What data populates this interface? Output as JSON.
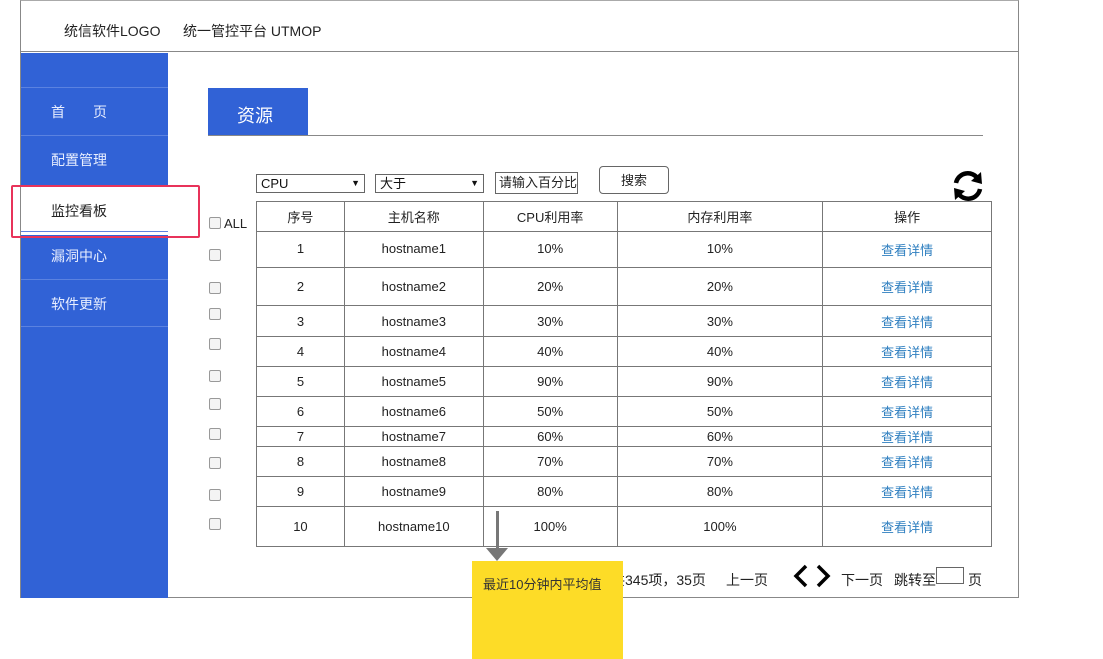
{
  "header": {
    "logo": "统信软件LOGO",
    "platform": "统一管控平台 UTMOP"
  },
  "sidebar": {
    "items": [
      {
        "label": "首　　页"
      },
      {
        "label": "配置管理"
      },
      {
        "label": "监控看板"
      },
      {
        "label": "漏洞中心"
      },
      {
        "label": "软件更新"
      }
    ]
  },
  "tab": {
    "label": "资源"
  },
  "filters": {
    "metric": "CPU",
    "operator": "大于",
    "pct_placeholder": "请输入百分比",
    "search_label": "搜索",
    "all_label": "ALL"
  },
  "table": {
    "headers": [
      "序号",
      "主机名称",
      "CPU利用率",
      "内存利用率",
      "操作"
    ],
    "rows": [
      {
        "no": "1",
        "host": "hostname1",
        "cpu": "10%",
        "mem": "10%",
        "action": "查看详情"
      },
      {
        "no": "2",
        "host": "hostname2",
        "cpu": "20%",
        "mem": "20%",
        "action": "查看详情"
      },
      {
        "no": "3",
        "host": "hostname3",
        "cpu": "30%",
        "mem": "30%",
        "action": "查看详情"
      },
      {
        "no": "4",
        "host": "hostname4",
        "cpu": "40%",
        "mem": "40%",
        "action": "查看详情"
      },
      {
        "no": "5",
        "host": "hostname5",
        "cpu": "90%",
        "mem": "90%",
        "action": "查看详情"
      },
      {
        "no": "6",
        "host": "hostname6",
        "cpu": "50%",
        "mem": "50%",
        "action": "查看详情"
      },
      {
        "no": "7",
        "host": "hostname7",
        "cpu": "60%",
        "mem": "60%",
        "action": "查看详情"
      },
      {
        "no": "8",
        "host": "hostname8",
        "cpu": "70%",
        "mem": "70%",
        "action": "查看详情"
      },
      {
        "no": "9",
        "host": "hostname9",
        "cpu": "80%",
        "mem": "80%",
        "action": "查看详情"
      },
      {
        "no": "10",
        "host": "hostname10",
        "cpu": "100%",
        "mem": "100%",
        "action": "查看详情"
      }
    ]
  },
  "pager": {
    "total": "共345项，35页",
    "prev": "上一页",
    "next": "下一页",
    "jump_prefix": "跳转至",
    "jump_suffix": "页"
  },
  "note": {
    "text": "最近10分钟内平均值"
  },
  "colors": {
    "sidebar": "#3162d6",
    "link": "#2f7fc0",
    "note": "#fddc27",
    "highlight": "#e8335a"
  }
}
